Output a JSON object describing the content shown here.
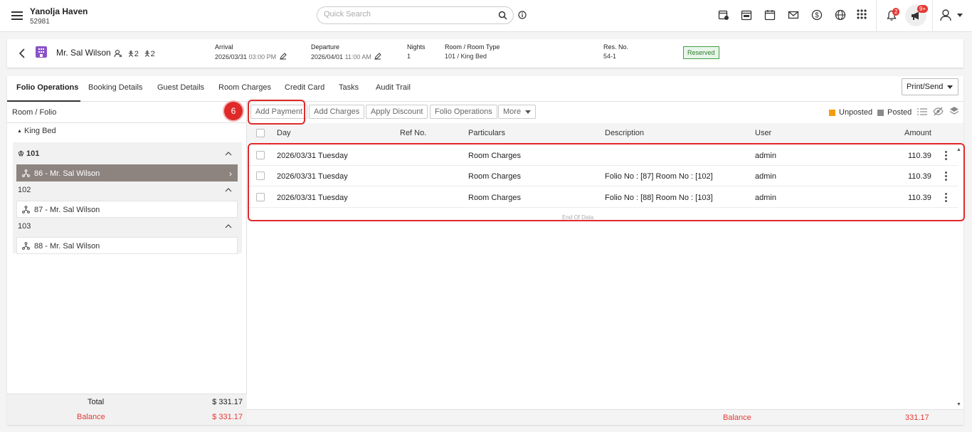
{
  "header": {
    "property_name": "Yanolja Haven",
    "property_code": "52981",
    "search_placeholder": "Quick Search",
    "notif_badge": "2",
    "announce_badge": "9+"
  },
  "reservation": {
    "guest": "Mr. Sal Wilson",
    "adults": "2",
    "children": "2",
    "arrival_label": "Arrival",
    "arrival_date": "2026/03/31",
    "arrival_time": "03:00 PM",
    "departure_label": "Departure",
    "departure_date": "2026/04/01",
    "departure_time": "11:00 AM",
    "nights_label": "Nights",
    "nights": "1",
    "room_label": "Room / Room Type",
    "room": "101 / King Bed",
    "resno_label": "Res. No.",
    "resno": "54-1",
    "status": "Reserved",
    "status_color": "#43a047"
  },
  "tabs": [
    "Folio Operations",
    "Booking Details",
    "Guest Details",
    "Room Charges",
    "Credit Card",
    "Tasks",
    "Audit Trail"
  ],
  "print_send": "Print/Send",
  "left": {
    "header": "Room / Folio",
    "room_type": "King Bed",
    "groups": [
      {
        "room": "101",
        "folio": "86 - Mr. Sal Wilson"
      },
      {
        "room": "102",
        "folio": "87 - Mr. Sal Wilson"
      },
      {
        "room": "103",
        "folio": "88 - Mr. Sal Wilson"
      }
    ],
    "total_label": "Total",
    "total_value": "$ 331.17",
    "balance_label": "Balance",
    "balance_value": "$ 331.17"
  },
  "toolbar": {
    "add_payment": "Add Payment",
    "add_charges": "Add Charges",
    "apply_discount": "Apply Discount",
    "folio_operations": "Folio Operations",
    "more": "More",
    "unposted": "Unposted",
    "posted": "Posted",
    "unposted_color": "#f39c12",
    "posted_color": "#8a8a8a"
  },
  "step_number": "6",
  "table": {
    "columns": [
      "Day",
      "Ref No.",
      "Particulars",
      "Description",
      "User",
      "Amount"
    ],
    "rows": [
      {
        "day": "2026/03/31 Tuesday",
        "ref": "",
        "particulars": "Room Charges",
        "description": "",
        "user": "admin",
        "amount": "110.39"
      },
      {
        "day": "2026/03/31 Tuesday",
        "ref": "",
        "particulars": "Room Charges",
        "description": "Folio No : [87] Room No : [102]",
        "user": "admin",
        "amount": "110.39"
      },
      {
        "day": "2026/03/31 Tuesday",
        "ref": "",
        "particulars": "Room Charges",
        "description": "Folio No : [88] Room No : [103]",
        "user": "admin",
        "amount": "110.39"
      }
    ],
    "end_text": "End Of Data",
    "balance_label": "Balance",
    "balance_value": "331.17"
  }
}
